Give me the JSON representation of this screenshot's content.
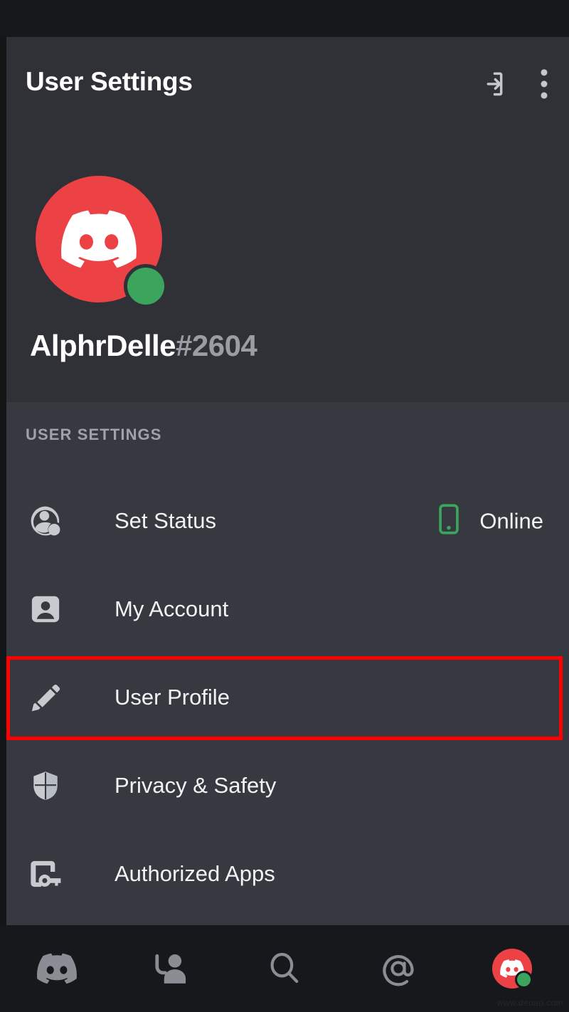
{
  "header": {
    "title": "User Settings",
    "logout_icon": "logout-icon",
    "overflow_icon": "more-vertical-icon"
  },
  "profile": {
    "avatar_icon": "discord-logo-icon",
    "avatar_color": "#ed4245",
    "status_color": "#3ba55d",
    "status": "online",
    "username": "AlphrDelle",
    "discriminator": "#2604"
  },
  "settings": {
    "section_label": "USER SETTINGS",
    "items": [
      {
        "label": "Set Status",
        "icon": "person-status-icon",
        "value": "Online",
        "value_icon": "mobile-phone-icon",
        "value_icon_color": "#3ba55d",
        "highlighted": false
      },
      {
        "label": "My Account",
        "icon": "account-badge-icon",
        "value": "",
        "value_icon": "",
        "highlighted": false
      },
      {
        "label": "User Profile",
        "icon": "pencil-icon",
        "value": "",
        "value_icon": "",
        "highlighted": true
      },
      {
        "label": "Privacy & Safety",
        "icon": "shield-icon",
        "value": "",
        "value_icon": "",
        "highlighted": false
      },
      {
        "label": "Authorized Apps",
        "icon": "authorized-apps-icon",
        "value": "",
        "value_icon": "",
        "highlighted": false
      }
    ]
  },
  "annotation": {
    "color": "#ff0000",
    "target": "User Profile"
  },
  "bottom_nav": {
    "items": [
      {
        "icon": "discord-home-icon",
        "active": false
      },
      {
        "icon": "friends-icon",
        "active": false
      },
      {
        "icon": "search-icon",
        "active": false
      },
      {
        "icon": "mentions-at-icon",
        "active": false
      },
      {
        "icon": "user-avatar-icon",
        "active": true
      }
    ]
  },
  "watermark": {
    "text": "www.deuao.com"
  }
}
